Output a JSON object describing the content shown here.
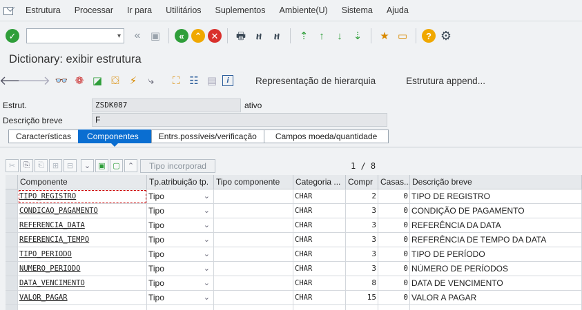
{
  "menu": [
    "Estrutura",
    "Processar",
    "Ir para",
    "Utilitários",
    "Suplementos",
    "Ambiente(U)",
    "Sistema",
    "Ajuda"
  ],
  "title": "Dictionary: exibir estrutura",
  "app_toolbar": {
    "hierarchy_button": "Representação de hierarquia",
    "append_button": "Estrutura append..."
  },
  "header": {
    "estrut_label": "Estrut.",
    "estrut_value": "ZSDK087",
    "status": "ativo",
    "desc_label": "Descrição breve",
    "desc_value": "F"
  },
  "tabs": [
    {
      "label": "Características",
      "active": false
    },
    {
      "label": "Componentes",
      "active": true
    },
    {
      "label": "Entrs.possíveis/verificação",
      "active": false
    },
    {
      "label": "Campos moeda/quantidade",
      "active": false
    }
  ],
  "table_toolbar": {
    "tipo_button": "Tipo incorporad",
    "pager": "1 / 8"
  },
  "columns": [
    "Componente",
    "Tp.atribuição tp.",
    "Tipo componente",
    "Categoria ...",
    "Compr",
    "Casas...",
    "Descrição breve"
  ],
  "rows": [
    {
      "componente": "TIPO_REGISTRO",
      "tp": "Tipo",
      "tipo_comp": "",
      "categoria": "CHAR",
      "compr": "2",
      "casas": "0",
      "descricao": "TIPO DE REGISTRO"
    },
    {
      "componente": "CONDICAO_PAGAMENTO",
      "tp": "Tipo",
      "tipo_comp": "",
      "categoria": "CHAR",
      "compr": "3",
      "casas": "0",
      "descricao": "CONDIÇÃO DE PAGAMENTO"
    },
    {
      "componente": "REFERENCIA_DATA",
      "tp": "Tipo",
      "tipo_comp": "",
      "categoria": "CHAR",
      "compr": "3",
      "casas": "0",
      "descricao": "REFERÊNCIA DA DATA"
    },
    {
      "componente": "REFERENCIA_TEMPO",
      "tp": "Tipo",
      "tipo_comp": "",
      "categoria": "CHAR",
      "compr": "3",
      "casas": "0",
      "descricao": "REFERÊNCIA DE TEMPO DA DATA"
    },
    {
      "componente": "TIPO_PERIODO",
      "tp": "Tipo",
      "tipo_comp": "",
      "categoria": "CHAR",
      "compr": "3",
      "casas": "0",
      "descricao": "TIPO DE PERÍODO"
    },
    {
      "componente": "NUMERO_PERIODO",
      "tp": "Tipo",
      "tipo_comp": "",
      "categoria": "CHAR",
      "compr": "3",
      "casas": "0",
      "descricao": "NÚMERO DE PERÍODOS"
    },
    {
      "componente": "DATA_VENCIMENTO",
      "tp": "Tipo",
      "tipo_comp": "",
      "categoria": "CHAR",
      "compr": "8",
      "casas": "0",
      "descricao": "DATA DE VENCIMENTO"
    },
    {
      "componente": "VALOR_PAGAR",
      "tp": "Tipo",
      "tipo_comp": "",
      "categoria": "CHAR",
      "compr": "15",
      "casas": "0",
      "descricao": "VALOR A PAGAR"
    }
  ],
  "colors": {
    "accent": "#0a6ed1",
    "ok_green": "#2f9e3a",
    "cancel_red": "#d9302c",
    "warn_orange": "#f0a800"
  }
}
